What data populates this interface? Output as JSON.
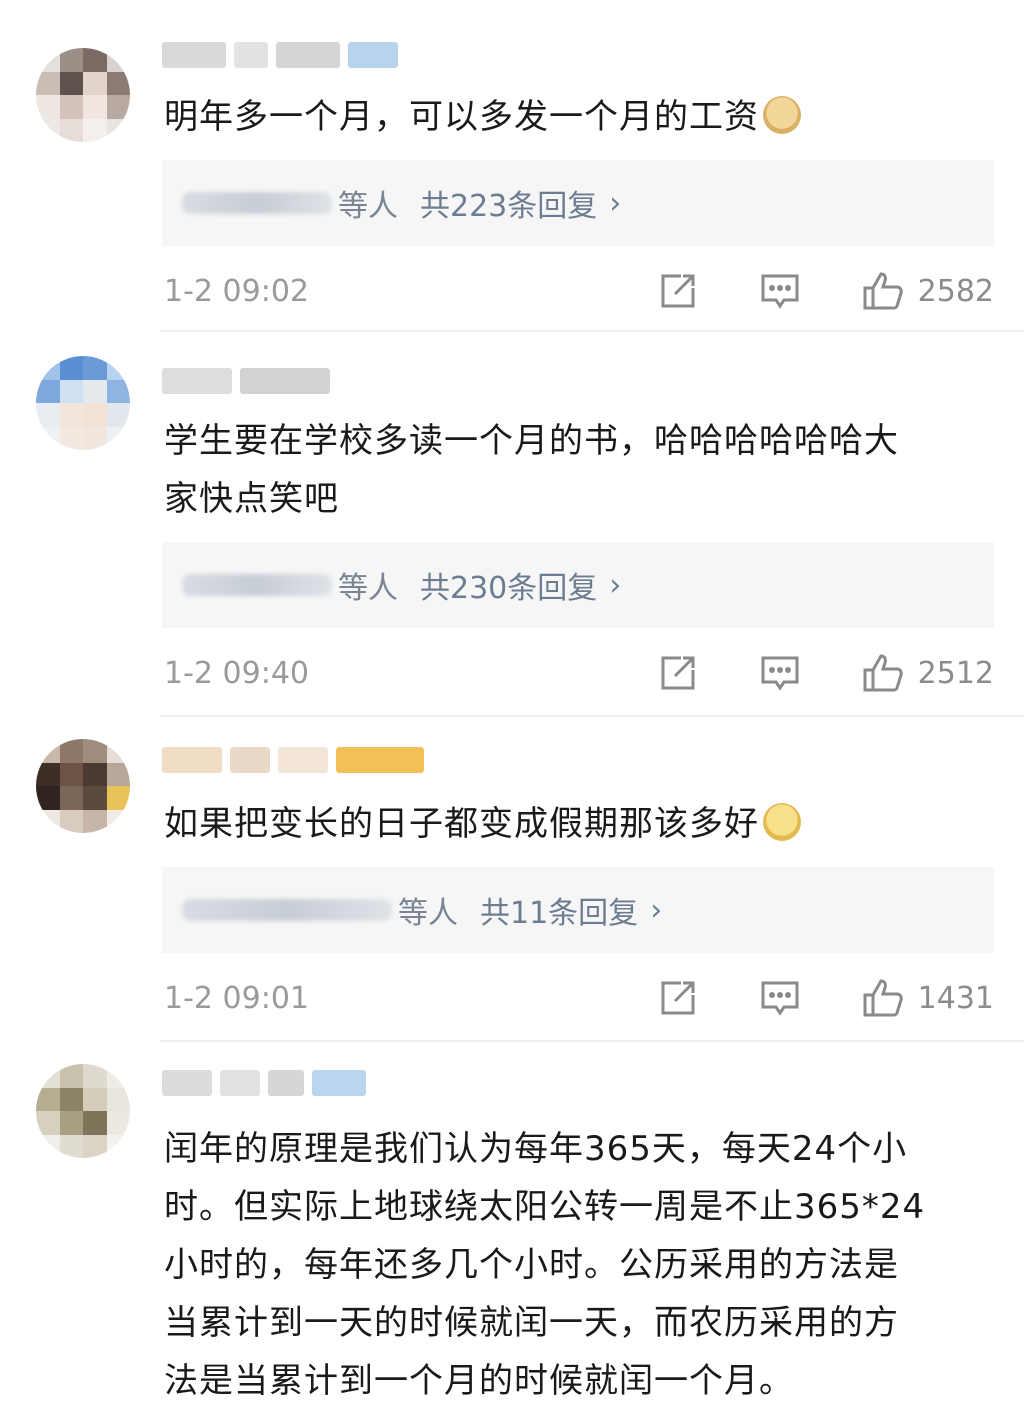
{
  "comments": [
    {
      "text": "明年多一个月，可以多发一个月的工资",
      "emoji": "doge-face",
      "reply_who": "等人",
      "reply_count": "共223条回复",
      "time": "1-2 09:02",
      "likes": "2582"
    },
    {
      "text": "学生要在学校多读一个月的书，哈哈哈哈哈哈大\n家快点笑吧",
      "reply_who": "等人",
      "reply_count": "共230条回复",
      "time": "1-2 09:40",
      "likes": "2512"
    },
    {
      "text": "如果把变长的日子都变成假期那该多好",
      "emoji": "crying-face",
      "reply_who": "等人",
      "reply_count": "共11条回复",
      "time": "1-2 09:01",
      "likes": "1431"
    },
    {
      "text": "闰年的原理是我们认为每年365天，每天24个小\n时。但实际上地球绕太阳公转一周是不止365*24\n小时的，每年还多几个小时。公历采用的方法是\n当累计到一天的时候就闰一天，而农历采用的方\n法是当累计到一个月的时候就闰一个月。"
    }
  ],
  "icons": {
    "share": "share-icon",
    "comment": "comment-icon",
    "like": "thumbs-up-icon",
    "reply_arrow": "chevron-right-icon"
  },
  "colors": {
    "reply_link": "#6d7d91",
    "meta_text": "#9a9a9a",
    "reply_bg": "#f6f6f6"
  }
}
